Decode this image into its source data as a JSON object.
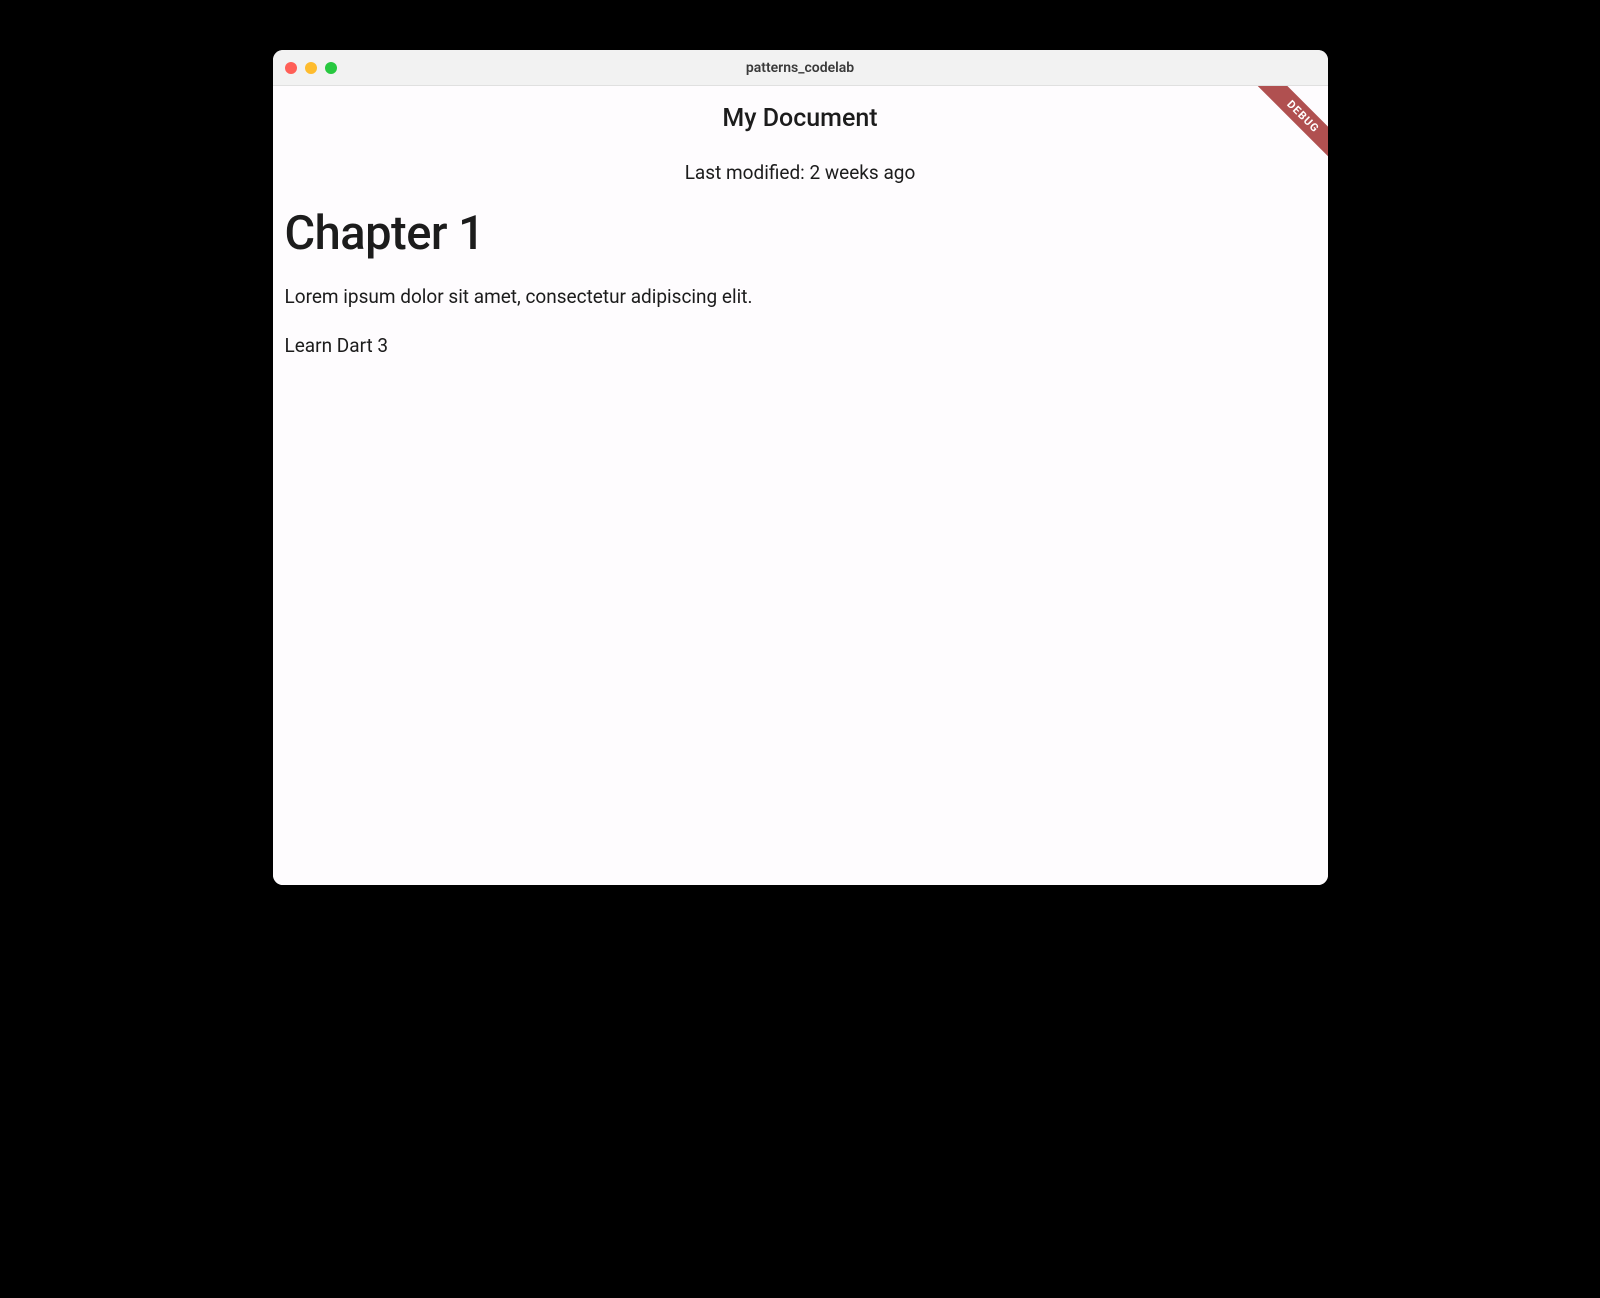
{
  "window": {
    "title": "patterns_codelab"
  },
  "debug_banner": "DEBUG",
  "document": {
    "title": "My Document",
    "last_modified": "Last modified: 2 weeks ago",
    "chapter_heading": "Chapter 1",
    "body": "Lorem ipsum dolor sit amet, consectetur adipiscing elit.",
    "link": "Learn Dart 3"
  }
}
